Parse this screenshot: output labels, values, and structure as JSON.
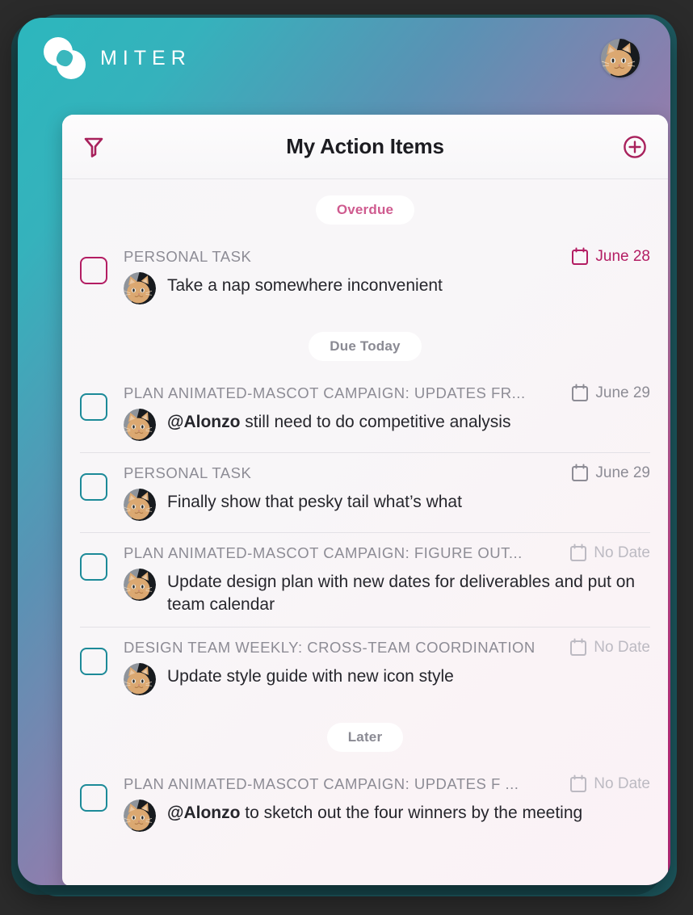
{
  "brand": {
    "name": "MITER",
    "logo_icon": "miter-circles-logo",
    "avatar_icon": "user-avatar-cat"
  },
  "colors": {
    "gradient_start": "#2cb7bd",
    "gradient_mid": "#8a7fae",
    "gradient_end": "#c22f80",
    "accent_magenta": "#b31d63",
    "accent_teal": "#1c8a98",
    "overdue_text": "#cf5b8f",
    "muted_text": "#8d8c95",
    "nodate_text": "#bcbac2",
    "card_bg": "#f8f6f8",
    "page_bg": "#2b2b2b"
  },
  "card": {
    "title": "My Action Items",
    "filter_icon": "filter-funnel-icon",
    "add_icon": "add-circle-plus-icon"
  },
  "sections": [
    {
      "label": "Overdue",
      "style": "overdue",
      "items": [
        {
          "meeting": "PERSONAL TASK",
          "date": "June 28",
          "date_style": "overdue",
          "calendar_icon": "calendar-icon",
          "avatar_icon": "user-avatar-cat",
          "checkbox_style": "overdue",
          "mention": "",
          "text": "Take a nap somewhere inconvenient"
        }
      ]
    },
    {
      "label": "Due Today",
      "style": "normal",
      "items": [
        {
          "meeting": "PLAN ANIMATED-MASCOT CAMPAIGN: UPDATES FR...",
          "date": "June 29",
          "date_style": "normal",
          "calendar_icon": "calendar-icon",
          "avatar_icon": "user-avatar-cat",
          "checkbox_style": "normal",
          "mention": "@Alonzo",
          "text": " still need to do competitive analysis"
        },
        {
          "meeting": "PERSONAL TASK",
          "date": "June 29",
          "date_style": "normal",
          "calendar_icon": "calendar-icon",
          "avatar_icon": "user-avatar-cat",
          "checkbox_style": "normal",
          "mention": "",
          "text": "Finally show that pesky tail what’s what"
        },
        {
          "meeting": "PLAN ANIMATED-MASCOT CAMPAIGN: FIGURE OUT...",
          "date": "No Date",
          "date_style": "nodate",
          "calendar_icon": "calendar-icon",
          "avatar_icon": "user-avatar-cat",
          "checkbox_style": "normal",
          "mention": "",
          "text": "Update design plan with new dates for deliverables and put on team calendar"
        },
        {
          "meeting": "DESIGN TEAM WEEKLY: CROSS-TEAM COORDINATION",
          "date": "No Date",
          "date_style": "nodate",
          "calendar_icon": "calendar-icon",
          "avatar_icon": "user-avatar-cat",
          "checkbox_style": "normal",
          "mention": "",
          "text": "Update style guide with new icon style"
        }
      ]
    },
    {
      "label": "Later",
      "style": "normal",
      "items": [
        {
          "meeting": "PLAN ANIMATED-MASCOT CAMPAIGN: UPDATES F ...",
          "date": "No Date",
          "date_style": "nodate",
          "calendar_icon": "calendar-icon",
          "avatar_icon": "user-avatar-cat",
          "checkbox_style": "normal",
          "mention": "@Alonzo",
          "text": " to sketch out the four winners by the meeting"
        }
      ]
    }
  ]
}
